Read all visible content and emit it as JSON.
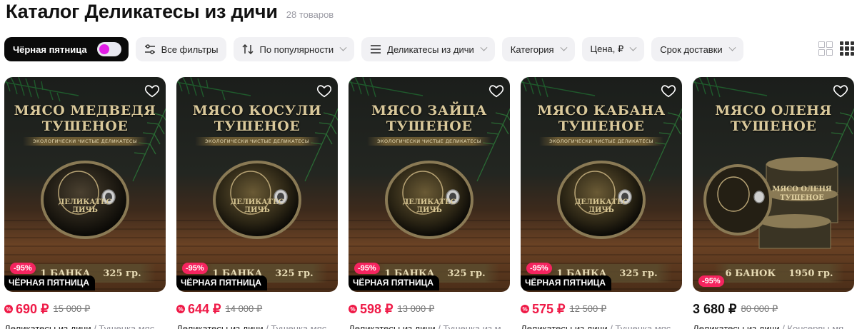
{
  "header": {
    "title": "Каталог Деликатесы из дичи",
    "count": "28 товаров"
  },
  "filters": {
    "black_friday": "Чёрная пятница",
    "all_filters": "Все фильтры",
    "sort": "По популярности",
    "section": "Деликатесы из дичи",
    "category": "Категория",
    "price": "Цена, ₽",
    "delivery": "Срок доставки"
  },
  "colors": {
    "accent": "#ef1a47",
    "toggle_knob": "#e11ee6",
    "discount_badge": "#f5245f"
  },
  "products": [
    {
      "title_line1": "МЯСО МЕДВЕДЯ",
      "title_line2": "ТУШЕНОЕ",
      "subtitle": "ЭКОЛОГИЧЕСКИ ЧИСТЫЕ ДЕЛИКАТЕСЫ",
      "can_brand1": "ДЕЛИКАТЕС",
      "can_brand2": "ДИЧЬ",
      "qty": "1 БАНКА",
      "weight": "325 гр.",
      "discount": "-95%",
      "promo": "ЧЁРНАЯ ПЯТНИЦА",
      "price": "690 ₽",
      "old_price": "15 000 ₽",
      "brand": "Деликатесы из дичи",
      "category": " / Тушенка мяс"
    },
    {
      "title_line1": "МЯСО КОСУЛИ",
      "title_line2": "ТУШЕНОЕ",
      "subtitle": "ЭКОЛОГИЧЕСКИ ЧИСТЫЕ ДЕЛИКАТЕСЫ",
      "can_brand1": "ДЕЛИКАТЕС",
      "can_brand2": "ДИЧЬ",
      "qty": "1 БАНКА",
      "weight": "325 гр.",
      "discount": "-95%",
      "promo": "ЧЁРНАЯ ПЯТНИЦА",
      "price": "644 ₽",
      "old_price": "14 000 ₽",
      "brand": "Деликатесы из дичи",
      "category": " / Тушенка мяс"
    },
    {
      "title_line1": "МЯСО ЗАЙЦА",
      "title_line2": "ТУШЕНОЕ",
      "subtitle": "ЭКОЛОГИЧЕСКИ ЧИСТЫЕ ДЕЛИКАТЕСЫ",
      "can_brand1": "ДЕЛИКАТЕС",
      "can_brand2": "ДИЧЬ",
      "qty": "1 БАНКА",
      "weight": "325 гр.",
      "discount": "-95%",
      "promo": "ЧЁРНАЯ ПЯТНИЦА",
      "price": "598 ₽",
      "old_price": "13 000 ₽",
      "brand": "Деликатесы из дичи",
      "category": " / Тушенка из м"
    },
    {
      "title_line1": "МЯСО КАБАНА",
      "title_line2": "ТУШЕНОЕ",
      "subtitle": "ЭКОЛОГИЧЕСКИ ЧИСТЫЕ ДЕЛИКАТЕСЫ",
      "can_brand1": "ДЕЛИКАТЕС",
      "can_brand2": "ДИЧЬ",
      "qty": "1 БАНКА",
      "weight": "325 гр.",
      "discount": "-95%",
      "promo": "ЧЁРНАЯ ПЯТНИЦА",
      "price": "575 ₽",
      "old_price": "12 500 ₽",
      "brand": "Деликатесы из дичи",
      "category": " / Тушенка мяс"
    },
    {
      "title_line1": "МЯСО ОЛЕНЯ",
      "title_line2": "ТУШЕНОЕ",
      "subtitle": "",
      "can_brand1": "МЯСО ОЛЕНЯ",
      "can_brand2": "ТУШЕНОЕ",
      "qty": "6 БАНОК",
      "weight": "1950 гр.",
      "discount": "-95%",
      "promo": "",
      "price": "3 680 ₽",
      "old_price": "80 000 ₽",
      "brand": "Деликатесы из дичи",
      "category": " / Консервы мя"
    }
  ]
}
